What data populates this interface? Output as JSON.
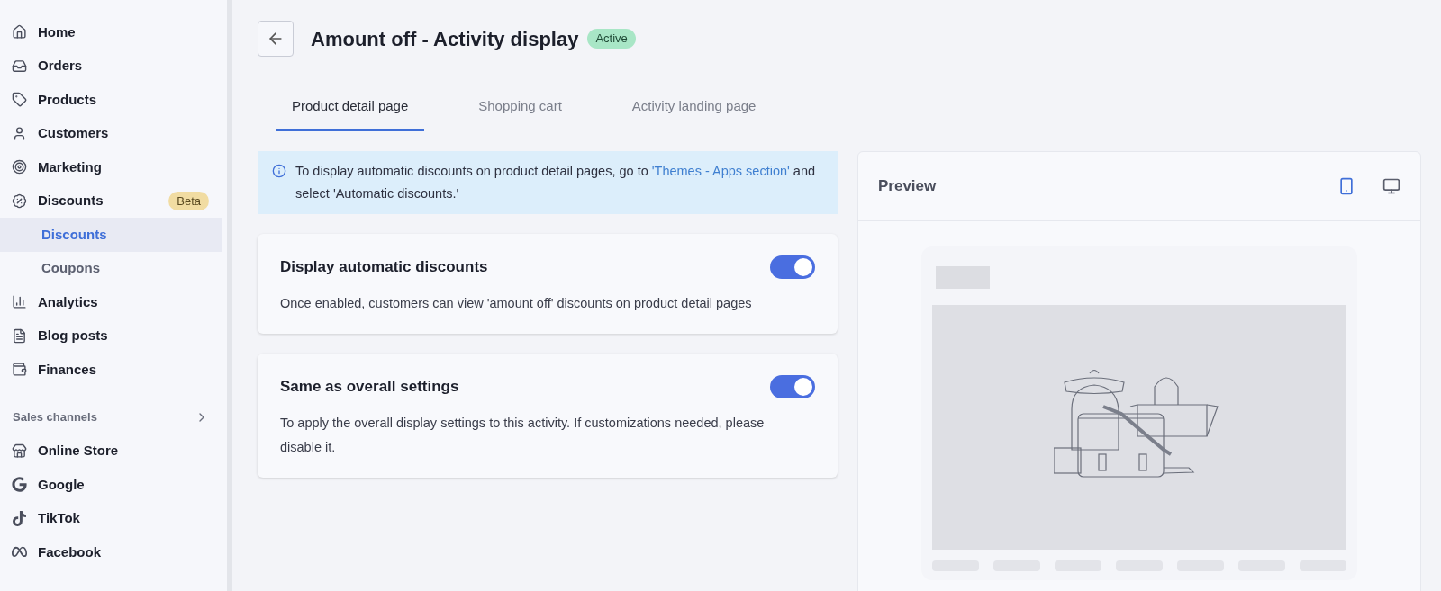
{
  "sidebar": {
    "items": [
      {
        "kind": "item",
        "label": "Home"
      },
      {
        "kind": "item",
        "label": "Orders"
      },
      {
        "kind": "item",
        "label": "Products"
      },
      {
        "kind": "item",
        "label": "Customers"
      },
      {
        "kind": "item",
        "label": "Marketing"
      },
      {
        "kind": "item",
        "label": "Discounts",
        "badge": "Beta"
      },
      {
        "kind": "subitem",
        "label": "Discounts",
        "selected": true
      },
      {
        "kind": "subitem",
        "label": "Coupons",
        "selected": false
      },
      {
        "kind": "item",
        "label": "Analytics"
      },
      {
        "kind": "item",
        "label": "Blog posts"
      },
      {
        "kind": "item",
        "label": "Finances"
      }
    ],
    "section": {
      "label": "Sales channels"
    },
    "channels": [
      {
        "label": "Online Store"
      },
      {
        "label": "Google"
      },
      {
        "label": "TikTok"
      },
      {
        "label": "Facebook"
      }
    ]
  },
  "header": {
    "title": "Amount off - Activity display",
    "status": "Active"
  },
  "tabs": [
    {
      "label": "Product detail page",
      "selected": true
    },
    {
      "label": "Shopping cart",
      "selected": false
    },
    {
      "label": "Activity landing page",
      "selected": false
    }
  ],
  "notice": {
    "before": "To display automatic discounts on product detail pages, go to ",
    "link": "'Themes - Apps section'",
    "after": " and select 'Automatic discounts.'"
  },
  "settings": [
    {
      "title": "Display automatic discounts",
      "description": "Once enabled, customers can view 'amount off' discounts on product detail pages",
      "on": true
    },
    {
      "title": "Same as overall settings",
      "description": "To apply the overall display settings to this activity. If customizations needed, please disable it.",
      "on": true
    }
  ],
  "preview": {
    "title": "Preview",
    "devices": [
      {
        "kind": "mobile",
        "selected": true
      },
      {
        "kind": "desktop",
        "selected": false
      }
    ]
  }
}
